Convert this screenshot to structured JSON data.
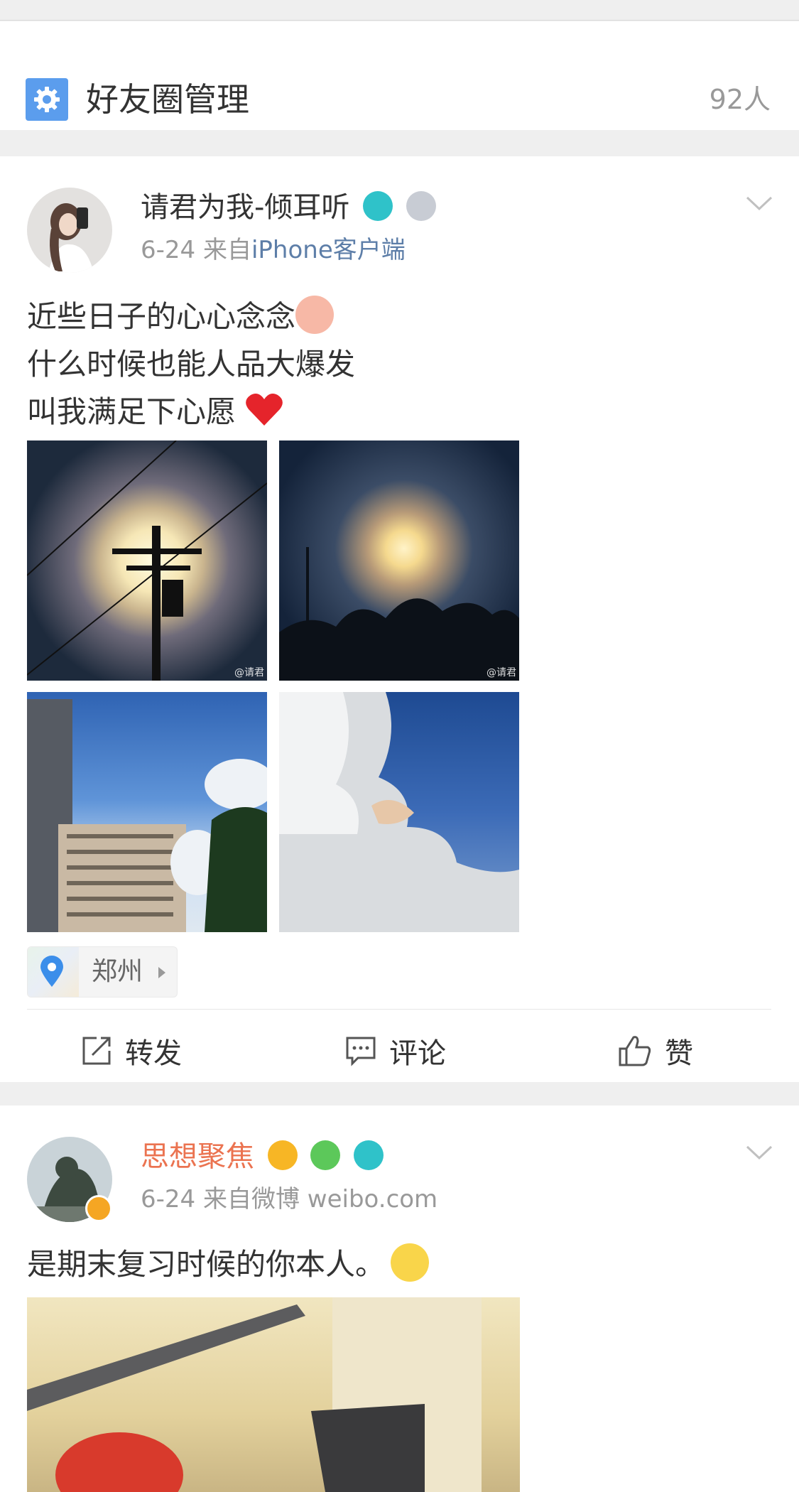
{
  "manage": {
    "title": "好友圈管理",
    "count": "92人"
  },
  "posts": [
    {
      "username": "请君为我-倾耳听",
      "date": "6-24",
      "from_prefix": "来自",
      "source": "iPhone客户端",
      "text_lines": [
        "近些日子的心心念念",
        "什么时候也能人品大爆发",
        "叫我满足下心愿"
      ],
      "watermark": "@请君",
      "location": "郑州",
      "actions": {
        "repost": "转发",
        "comment": "评论",
        "like": "赞"
      }
    },
    {
      "username": "思想聚焦",
      "date": "6-24",
      "from_prefix": "来自微博",
      "source": "weibo.com",
      "text_lines": [
        "是期末复习时候的你本人。"
      ],
      "colors": {
        "name": "#eb7350"
      }
    }
  ]
}
